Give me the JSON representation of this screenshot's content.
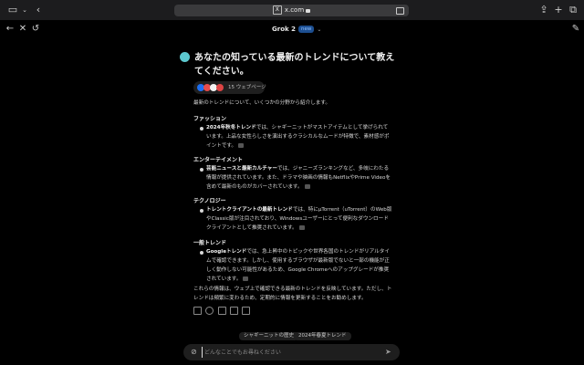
{
  "browser": {
    "url": "x.com",
    "icons": [
      "sidebar-icon",
      "chevron-down-icon",
      "back-icon",
      "share-icon",
      "new-tab-icon",
      "tabs-icon"
    ]
  },
  "nav": {
    "model_name": "Grok 2",
    "badge": "new"
  },
  "question": "あなたの知っている最新のトレンドについて教えてください。",
  "sources": {
    "count_label": "15 ウェブページ",
    "colors": [
      "#1d6ff2",
      "#e64b4b",
      "#f1f1f1",
      "#d44"
    ]
  },
  "intro": "最新のトレンドについて、いくつかの分野から紹介します。",
  "sections": [
    {
      "heading": "ファッション",
      "lead": "2024年秋冬トレンド",
      "text": "では、シャギーニットがマストアイテムとして挙げられています。上品な女性らしさを演出するクラシカルなムードが特徴で、素材感がポイントです。"
    },
    {
      "heading": "エンターテイメント",
      "lead": "芸能ニュースと最新カルチャー",
      "text": "では、ジャニーズランキングなど、多岐にわたる情報が提供されています。また、ドラマや映画の情報もNetflixやPrime Videoを含めて最新のものがカバーされています。"
    },
    {
      "heading": "テクノロジー",
      "lead": "トレントクライアントの最新トレンド",
      "text": "では、特にμTorrent（uTorrent）のWeb版やClassic版が注目されており、Windowsユーザーにとって便利なダウンロードクライアントとして推奨されています。"
    },
    {
      "heading": "一般トレンド",
      "lead": "Googleトレンド",
      "text": "では、急上昇中のトピックや世界各国のトレンドがリアルタイムで確認できます。しかし、使用するブラウザが最新版でないと一部の機能が正しく動作しない可能性があるため、Google Chromeへのアップグレードが推奨されています。"
    }
  ],
  "outro": "これらの情報は、ウェブ上で確認できる最新のトレンドを反映しています。ただし、トレンドは頻繁に変わるため、定期的に情報を更新することをお勧めします。",
  "actions": [
    "copy-icon",
    "regenerate-icon",
    "share-icon",
    "thumbs-up-icon",
    "thumbs-down-icon"
  ],
  "suggestions": [
    "シャギーニットの歴史",
    "2024年春夏トレンド"
  ],
  "composer": {
    "placeholder": "どんなことでもお尋ねください"
  }
}
